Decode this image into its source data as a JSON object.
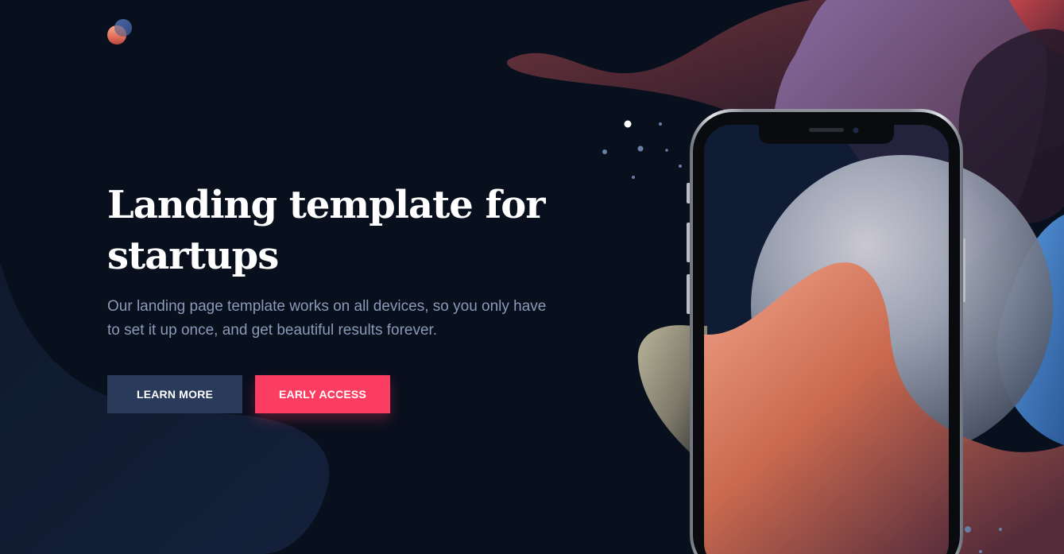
{
  "hero": {
    "title": "Landing template for startups",
    "subtitle": "Our landing page template works on all devices, so you only have to set it up once, and get beautiful results forever."
  },
  "buttons": {
    "learn_more": "LEARN MORE",
    "early_access": "EARLY ACCESS"
  },
  "logo": {
    "icon": "logo-icon"
  },
  "illustration": {
    "device": "smartphone-mockup"
  },
  "colors": {
    "background": "#080f1d",
    "primary_button": "#fc3d62",
    "secondary_button": "#2a3a5a",
    "title": "#ffffff",
    "subtitle": "#8a9ab8"
  }
}
